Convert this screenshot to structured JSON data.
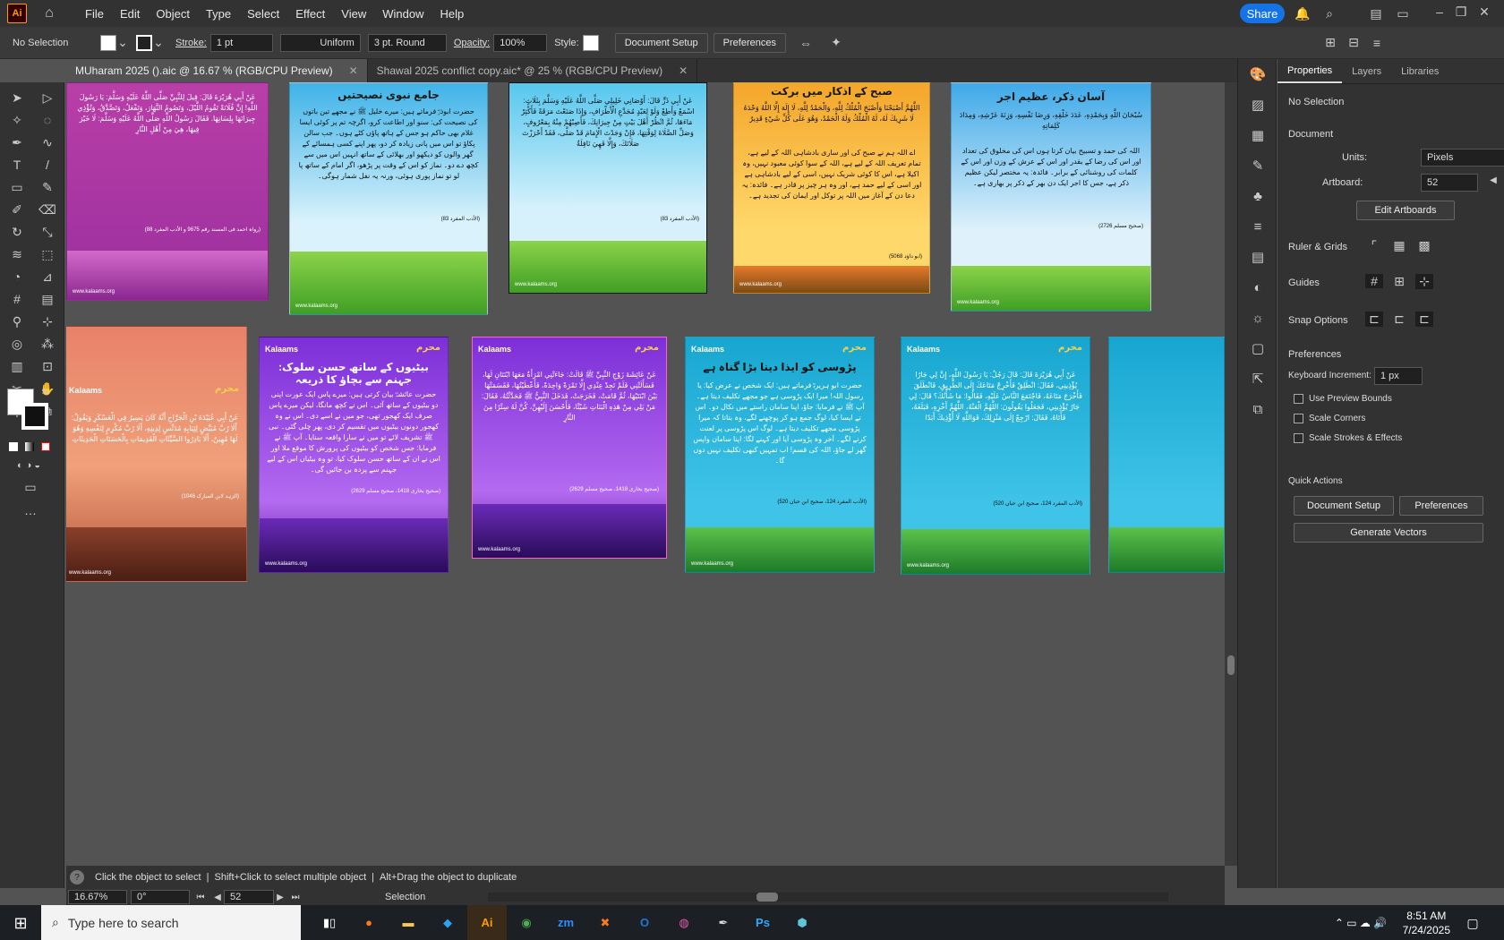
{
  "menubar": {
    "logo": "Ai",
    "items": [
      "File",
      "Edit",
      "Object",
      "Type",
      "Select",
      "Effect",
      "View",
      "Window",
      "Help"
    ],
    "share_label": "Share"
  },
  "control_bar": {
    "selection": "No Selection",
    "stroke_label": "Stroke:",
    "stroke_value": "1 pt",
    "stroke_style": "Uniform",
    "brush": "3 pt. Round",
    "opacity_label": "Opacity:",
    "opacity_value": "100%",
    "style_label": "Style:",
    "document_setup": "Document Setup",
    "preferences": "Preferences"
  },
  "tabs": [
    {
      "label": "MUharam 2025 ().aic @ 16.67 % (RGB/CPU Preview)"
    },
    {
      "label": "Shawal 2025 conflict copy.aic* @ 25 % (RGB/CPU Preview)"
    }
  ],
  "artboards": {
    "row1": [
      {
        "color_top": "#b93ea8",
        "color_bottom": "#9b2f9e",
        "title": "",
        "arabic": "عَنْ أَبِي هُرَيْرَةَ قَالَ: قِيلَ لِلنَّبِيِّ صَلَّى اللَّهُ عَلَيْهِ وَسَلَّمَ: يَا رَسُولَ اللَّهِ! إِنَّ فُلَانَةً تَقُومُ اللَّيْلَ، وَتَصُومُ النَّهَارَ، وَتَفْعَلُ، وَتَصَّدَّقُ، وَتُؤْذِي جِيرَانَهَا بِلِسَانِهَا. فَقَالَ رَسُولُ اللَّهِ صَلَّى اللَّهُ عَلَيْهِ وَسَلَّمَ: لَا خَيْرَ فِيهَا، هِيَ مِنْ أَهْلِ النَّارِ",
        "urdu": "",
        "ref": "(رواہ احمد فی المسند رقم 9675 و الأدب المفرد 88)",
        "site": "www.kalaams.org"
      },
      {
        "color_top": "#3fb3e8",
        "color_bottom": "#d9f2fb",
        "title": "جامع نبوی نصیحتیں",
        "arabic": "",
        "urdu": "حضرت ابوذرؓ فرماتے ہیں: میرے خلیل ﷺ نے مجھے تین باتوں کی نصیحت کی: سنو اور اطاعت کرو، اگرچہ تم پر کوئی ایسا غلام بھی حاکم ہو جس کے ہاتھ پاؤں کٹے ہوں۔ جب سالن پکاؤ تو اس میں پانی زیادہ کر دو، پھر اپنے کسی ہمسائے کے گھر والوں کو دیکھو اور بھلائی کے ساتھ انہیں اس میں سے کچھ دے دو۔ نماز کو اس کے وقت پر پڑھو، اگر امام کے ساتھ پا لو تو نماز پوری ہوئی، ورنہ یہ نفل شمار ہوگی۔",
        "ref": "(الأدب المفرد 83)",
        "site": "www.kalaams.org"
      },
      {
        "color_top": "#56c7ee",
        "color_bottom": "#d6f1fb",
        "title": "",
        "arabic": "عَنْ أَبِي ذَرٍّ قَالَ: أَوْصَانِي خَلِيلِي صَلَّى اللَّهُ عَلَيْهِ وَسَلَّمَ بِثَلَاثٍ: اسْمَعْ وَأَطِعْ وَلَوْ لِعَبْدٍ مُجَدَّعِ الْأَطْرَافِ، وَإِذَا صَنَعْتَ مَرَقَةً فَأَكْثِرْ مَاءَهَا، ثُمَّ انْظُرْ أَهْلَ بَيْتٍ مِنْ جِيرَانِكَ، فَأَصِبْهُمْ مِنْهُ بِمَعْرُوفٍ، وَصَلِّ الصَّلَاةَ لِوَقْتِهَا، فَإِنْ وَجَدْتَ الْإِمَامَ قَدْ صَلَّى، فَقَدْ أَحْرَزْتَ صَلَاتَكَ، وَإِلَّا فَهِيَ نَافِلَةٌ",
        "urdu": "",
        "ref": "(الأدب المفرد 83)",
        "site": "www.kalaams.org"
      },
      {
        "color_top": "#f4a62a",
        "color_bottom": "#ffd86b",
        "title": "صبح کے اذکار میں برکت",
        "arabic": "اللَّهُمَّ أَصْبَحْنَا وَأَصْبَحَ الْمُلْكُ لِلَّهِ، وَالْحَمْدُ لِلَّهِ، لَا إِلَهَ إِلَّا اللَّهُ وَحْدَهُ لَا شَرِيكَ لَهُ، لَهُ الْمُلْكُ وَلَهُ الْحَمْدُ، وَهُوَ عَلَى كُلِّ شَيْءٍ قَدِيرٌ",
        "urdu": "اے اللہ ہم نے صبح کی اور ساری بادشاہی اللہ کے لیے ہے، تمام تعریف اللہ کے لیے ہے، اللہ کے سوا کوئی معبود نہیں، وہ اکیلا ہے، اس کا کوئی شریک نہیں، اسی کے لیے بادشاہی ہے اور اسی کے لیے حمد ہے، اور وہ ہر چیز پر قادر ہے۔ فائدہ: یہ دعا دن کے آغاز میں اللہ پر توکل اور ایمان کی تجدید ہے۔",
        "ref": "(ابو داؤد 5068)",
        "site": "www.kalaams.org"
      },
      {
        "color_top": "#3fa9e8",
        "color_bottom": "#dff2fb",
        "title": "آسان ذکر، عظیم اجر",
        "arabic": "سُبْحَانَ اللَّهِ وَبِحَمْدِهِ، عَدَدَ خَلْقِهِ، وَرِضَا نَفْسِهِ، وَزِنَةَ عَرْشِهِ، وَمِدَادَ كَلِمَاتِهِ",
        "urdu": "اللہ کی حمد و تسبیح بیان کرتا ہوں اس کی مخلوق کی تعداد اور اس کی رضا کے بقدر اور اس کے عرش کے وزن اور اس کے کلمات کی روشنائی کے برابر۔ فائدہ: یہ مختصر لیکن عظیم ذکر ہے، جس کا اجر ایک دن بھر کے ذکر پر بھاری ہے۔",
        "ref": "(صحیح مسلم 2726)",
        "site": "www.kalaams.org"
      }
    ],
    "row2": [
      {
        "color_top": "#e8826a",
        "color_bottom": "#f0a07a",
        "title": "",
        "arabic": "عَنْ أَبِي عُبَيْدَةَ بْنِ الْجَرَّاحِ أَنَّهُ كَانَ يَسِيرُ فِي الْعَسْكَرِ وَيَقُولُ: أَلَا رُبَّ مُبَيِّضٍ لِثِيَابِهِ مُدَنِّسٍ لِدِينِهِ، أَلَا رُبَّ مُكْرِمٍ لِنَفْسِهِ وَهُوَ لَهَا مُهِينٌ، أَلَا بَادِرُوا السَّيِّئَاتِ الْقَدِيمَاتِ بِالْحَسَنَاتِ الْحَدِيثَاتِ",
        "urdu": "",
        "ref": "(الزہد لابن المبارک 1046)",
        "brand": "Kalaams",
        "badge": "محرم",
        "site": "www.kalaams.org"
      },
      {
        "color_top": "#7d2fd8",
        "color_bottom": "#b46af0",
        "title": "بیٹیوں کے ساتھ حسن سلوک: جہنم سے بچاؤ کا ذریعہ",
        "arabic": "",
        "urdu": "حضرت عائشہؓ بیان کرتی ہیں: میرے پاس ایک عورت اپنی دو بیٹیوں کے ساتھ آئی۔ اس نے کچھ مانگا، لیکن میرے پاس صرف ایک کھجور تھی، جو میں نے اسے دی۔ اس نے وہ کھجور دونوں بیٹیوں میں تقسیم کر دی، پھر چلی گئی۔ نبی ﷺ تشریف لائے تو میں نے سارا واقعہ سنایا۔ آپ ﷺ نے فرمایا: جس شخص کو بیٹیوں کی پرورش کا موقع ملا اور اس نے ان کے ساتھ حسن سلوک کیا، تو وہ بیٹیاں اس کے لیے جہنم سے پردہ بن جائیں گی۔",
        "ref": "(صحیح بخاری 1418، صحیح مسلم 2629)",
        "brand": "Kalaams",
        "badge": "محرم",
        "site": "www.kalaams.org"
      },
      {
        "color_top": "#7d2fd8",
        "color_bottom": "#b46af0",
        "title": "",
        "arabic": "عَنْ عَائِشَةَ زَوْجِ النَّبِيِّ ﷺ قَالَتْ: جَاءَتْنِي امْرَأَةٌ مَعَهَا ابْنَتَانِ لَهَا، فَسَأَلَتْنِي فَلَمْ تَجِدْ عِنْدِي إِلَّا تَمْرَةً وَاحِدَةً، فَأَعْطَيْتُهَا، فَقَسَمَتْهَا بَيْنَ ابْنَتَيْهَا، ثُمَّ قَامَتْ، فَخَرَجَتْ، فَدَخَلَ النَّبِيُّ ﷺ فَحَدَّثْتُهُ، فَقَالَ: مَنْ يَلِي مِنْ هَذِهِ الْبَنَاتِ شَيْئًا، فَأَحْسَنَ إِلَيْهِنَّ، كُنَّ لَهُ سِتْرًا مِنَ النَّارِ",
        "urdu": "",
        "ref": "(صحیح بخاری 1418، صحیح مسلم 2629)",
        "brand": "Kalaams",
        "badge": "محرم",
        "site": "www.kalaams.org"
      },
      {
        "color_top": "#17a6d0",
        "color_bottom": "#3fc3e8",
        "title": "پڑوسی کو ایذا دینا بڑا گناہ ہے",
        "arabic": "",
        "urdu": "حضرت ابو ہریرہؓ فرماتے ہیں: ایک شخص نے عرض کیا: یا رسول اللہ! میرا ایک پڑوسی ہے جو مجھے تکلیف دیتا ہے۔ آپ ﷺ نے فرمایا: جاؤ، اپنا سامان راستے میں نکال دو۔ اس نے ایسا کیا، لوگ جمع ہو کر پوچھنے لگے، وہ بتاتا کہ میرا پڑوسی مجھے تکلیف دیتا ہے۔ لوگ اس پڑوسی پر لعنت کرنے لگے۔ آخر وہ پڑوسی آیا اور کہنے لگا: اپنا سامان واپس گھر لے جاؤ، اللہ کی قسم! اب تمہیں کبھی تکلیف نہیں دوں گا۔",
        "ref": "(الأدب المفرد 124، صحیح ابن حبان 520)",
        "brand": "Kalaams",
        "badge": "محرم",
        "site": "www.kalaams.org"
      },
      {
        "color_top": "#17a6d0",
        "color_bottom": "#3fc3e8",
        "title": "",
        "arabic": "عَنْ أَبِي هُرَيْرَةَ قَالَ: قَالَ رَجُلٌ: يَا رَسُولَ اللَّهِ، إِنَّ لِي جَارًا يُؤْذِينِي، فَقَالَ: انْطَلِقْ فَأَخْرِجْ مَتَاعَكَ إِلَى الطَّرِيقِ، فَانْطَلَقَ فَأَخْرَجَ مَتَاعَهُ، فَاجْتَمَعَ النَّاسُ عَلَيْهِ، فَقَالُوا: مَا شَأْنُكَ؟ قَالَ: لِي جَارٌ يُؤْذِينِي، فَجَعَلُوا يَقُولُونَ: اللَّهُمَّ الْعَنْهُ، اللَّهُمَّ أَخْزِهِ، فَبَلَغَهُ، فَأَتَاهُ، فَقَالَ: ارْجِعْ إِلَى مَنْزِلِكَ، فَوَاللَّهِ لَا أُؤْذِيكَ أَبَدًا",
        "urdu": "",
        "ref": "(الأدب المفرد 124، صحیح ابن حبان 520)",
        "brand": "Kalaams",
        "badge": "محرم",
        "site": "www.kalaams.org"
      },
      {
        "color_top": "#17a6d0",
        "color_bottom": "#3fc3e8",
        "title": "",
        "arabic": "",
        "urdu": "",
        "ref": "",
        "brand": "",
        "badge": "",
        "site": ""
      }
    ]
  },
  "status": {
    "hint_select": "Click the object to select",
    "hint_multi": "Shift+Click to select multiple object",
    "hint_dup": "Alt+Drag the object to duplicate",
    "zoom": "16.67%",
    "rotation": "0°",
    "artboard_num": "52",
    "mode": "Selection"
  },
  "properties": {
    "tabs": [
      "Properties",
      "Layers",
      "Libraries"
    ],
    "selection": "No Selection",
    "document_heading": "Document",
    "units_label": "Units:",
    "units_value": "Pixels",
    "artboard_label": "Artboard:",
    "artboard_value": "52",
    "edit_artboards": "Edit Artboards",
    "ruler_grids": "Ruler & Grids",
    "guides": "Guides",
    "snap_options": "Snap Options",
    "preferences_heading": "Preferences",
    "keyboard_increment_label": "Keyboard Increment:",
    "keyboard_increment_value": "1 px",
    "use_preview_bounds": "Use Preview Bounds",
    "scale_corners": "Scale Corners",
    "scale_strokes": "Scale Strokes & Effects",
    "quick_actions": "Quick Actions",
    "document_setup": "Document Setup",
    "preferences_btn": "Preferences",
    "generate_vectors": "Generate Vectors"
  },
  "taskbar": {
    "search_placeholder": "Type here to search",
    "apps": [
      "Firefox",
      "File Explorer",
      "VS Code",
      "Ai",
      "Chrome",
      "Zoom",
      "XAMPP",
      "Outlook",
      "Photos",
      "Pen",
      "Ps",
      "App"
    ],
    "time": "8:51 AM",
    "date": "7/24/2025"
  }
}
